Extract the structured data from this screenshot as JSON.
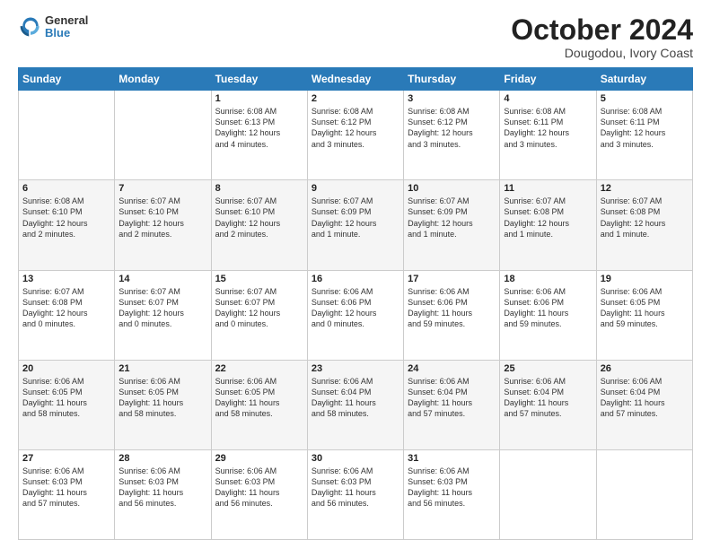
{
  "logo": {
    "general": "General",
    "blue": "Blue"
  },
  "header": {
    "month": "October 2024",
    "location": "Dougodou, Ivory Coast"
  },
  "days_of_week": [
    "Sunday",
    "Monday",
    "Tuesday",
    "Wednesday",
    "Thursday",
    "Friday",
    "Saturday"
  ],
  "weeks": [
    [
      {
        "day": "",
        "info": ""
      },
      {
        "day": "",
        "info": ""
      },
      {
        "day": "1",
        "info": "Sunrise: 6:08 AM\nSunset: 6:13 PM\nDaylight: 12 hours\nand 4 minutes."
      },
      {
        "day": "2",
        "info": "Sunrise: 6:08 AM\nSunset: 6:12 PM\nDaylight: 12 hours\nand 3 minutes."
      },
      {
        "day": "3",
        "info": "Sunrise: 6:08 AM\nSunset: 6:12 PM\nDaylight: 12 hours\nand 3 minutes."
      },
      {
        "day": "4",
        "info": "Sunrise: 6:08 AM\nSunset: 6:11 PM\nDaylight: 12 hours\nand 3 minutes."
      },
      {
        "day": "5",
        "info": "Sunrise: 6:08 AM\nSunset: 6:11 PM\nDaylight: 12 hours\nand 3 minutes."
      }
    ],
    [
      {
        "day": "6",
        "info": "Sunrise: 6:08 AM\nSunset: 6:10 PM\nDaylight: 12 hours\nand 2 minutes."
      },
      {
        "day": "7",
        "info": "Sunrise: 6:07 AM\nSunset: 6:10 PM\nDaylight: 12 hours\nand 2 minutes."
      },
      {
        "day": "8",
        "info": "Sunrise: 6:07 AM\nSunset: 6:10 PM\nDaylight: 12 hours\nand 2 minutes."
      },
      {
        "day": "9",
        "info": "Sunrise: 6:07 AM\nSunset: 6:09 PM\nDaylight: 12 hours\nand 1 minute."
      },
      {
        "day": "10",
        "info": "Sunrise: 6:07 AM\nSunset: 6:09 PM\nDaylight: 12 hours\nand 1 minute."
      },
      {
        "day": "11",
        "info": "Sunrise: 6:07 AM\nSunset: 6:08 PM\nDaylight: 12 hours\nand 1 minute."
      },
      {
        "day": "12",
        "info": "Sunrise: 6:07 AM\nSunset: 6:08 PM\nDaylight: 12 hours\nand 1 minute."
      }
    ],
    [
      {
        "day": "13",
        "info": "Sunrise: 6:07 AM\nSunset: 6:08 PM\nDaylight: 12 hours\nand 0 minutes."
      },
      {
        "day": "14",
        "info": "Sunrise: 6:07 AM\nSunset: 6:07 PM\nDaylight: 12 hours\nand 0 minutes."
      },
      {
        "day": "15",
        "info": "Sunrise: 6:07 AM\nSunset: 6:07 PM\nDaylight: 12 hours\nand 0 minutes."
      },
      {
        "day": "16",
        "info": "Sunrise: 6:06 AM\nSunset: 6:06 PM\nDaylight: 12 hours\nand 0 minutes."
      },
      {
        "day": "17",
        "info": "Sunrise: 6:06 AM\nSunset: 6:06 PM\nDaylight: 11 hours\nand 59 minutes."
      },
      {
        "day": "18",
        "info": "Sunrise: 6:06 AM\nSunset: 6:06 PM\nDaylight: 11 hours\nand 59 minutes."
      },
      {
        "day": "19",
        "info": "Sunrise: 6:06 AM\nSunset: 6:05 PM\nDaylight: 11 hours\nand 59 minutes."
      }
    ],
    [
      {
        "day": "20",
        "info": "Sunrise: 6:06 AM\nSunset: 6:05 PM\nDaylight: 11 hours\nand 58 minutes."
      },
      {
        "day": "21",
        "info": "Sunrise: 6:06 AM\nSunset: 6:05 PM\nDaylight: 11 hours\nand 58 minutes."
      },
      {
        "day": "22",
        "info": "Sunrise: 6:06 AM\nSunset: 6:05 PM\nDaylight: 11 hours\nand 58 minutes."
      },
      {
        "day": "23",
        "info": "Sunrise: 6:06 AM\nSunset: 6:04 PM\nDaylight: 11 hours\nand 58 minutes."
      },
      {
        "day": "24",
        "info": "Sunrise: 6:06 AM\nSunset: 6:04 PM\nDaylight: 11 hours\nand 57 minutes."
      },
      {
        "day": "25",
        "info": "Sunrise: 6:06 AM\nSunset: 6:04 PM\nDaylight: 11 hours\nand 57 minutes."
      },
      {
        "day": "26",
        "info": "Sunrise: 6:06 AM\nSunset: 6:04 PM\nDaylight: 11 hours\nand 57 minutes."
      }
    ],
    [
      {
        "day": "27",
        "info": "Sunrise: 6:06 AM\nSunset: 6:03 PM\nDaylight: 11 hours\nand 57 minutes."
      },
      {
        "day": "28",
        "info": "Sunrise: 6:06 AM\nSunset: 6:03 PM\nDaylight: 11 hours\nand 56 minutes."
      },
      {
        "day": "29",
        "info": "Sunrise: 6:06 AM\nSunset: 6:03 PM\nDaylight: 11 hours\nand 56 minutes."
      },
      {
        "day": "30",
        "info": "Sunrise: 6:06 AM\nSunset: 6:03 PM\nDaylight: 11 hours\nand 56 minutes."
      },
      {
        "day": "31",
        "info": "Sunrise: 6:06 AM\nSunset: 6:03 PM\nDaylight: 11 hours\nand 56 minutes."
      },
      {
        "day": "",
        "info": ""
      },
      {
        "day": "",
        "info": ""
      }
    ]
  ]
}
